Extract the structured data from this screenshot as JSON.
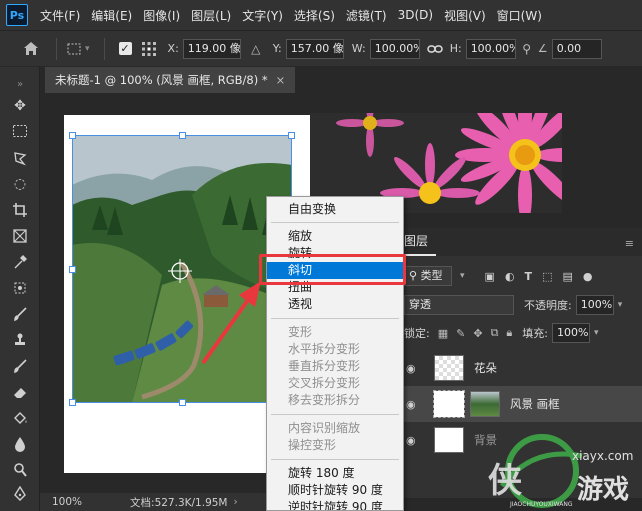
{
  "app": {
    "logo": "Ps"
  },
  "menu": [
    "文件(F)",
    "编辑(E)",
    "图像(I)",
    "图层(L)",
    "文字(Y)",
    "选择(S)",
    "滤镜(T)",
    "3D(D)",
    "视图(V)",
    "窗口(W)"
  ],
  "options": {
    "x_label": "X:",
    "x_value": "119.00 像",
    "y_label": "Y:",
    "y_value": "157.00 像",
    "w_label": "W:",
    "w_value": "100.00%",
    "h_label": "H:",
    "h_value": "100.00%",
    "angle_value": "0.00"
  },
  "document_tab": {
    "title": "未标题-1 @ 100% (风景 画框, RGB/8) *",
    "close": "×"
  },
  "context_menu": {
    "items": [
      {
        "label": "自由变换",
        "state": "enabled"
      },
      {
        "label": "缩放",
        "state": "enabled"
      },
      {
        "label": "旋转",
        "state": "enabled"
      },
      {
        "label": "斜切",
        "state": "highlighted"
      },
      {
        "label": "扭曲",
        "state": "enabled"
      },
      {
        "label": "透视",
        "state": "enabled"
      },
      {
        "label": "变形",
        "state": "disabled"
      },
      {
        "label": "水平拆分变形",
        "state": "disabled"
      },
      {
        "label": "垂直拆分变形",
        "state": "disabled"
      },
      {
        "label": "交叉拆分变形",
        "state": "disabled"
      },
      {
        "label": "移去变形拆分",
        "state": "disabled"
      },
      {
        "label": "内容识别缩放",
        "state": "disabled"
      },
      {
        "label": "操控变形",
        "state": "disabled"
      },
      {
        "label": "旋转 180 度",
        "state": "enabled"
      },
      {
        "label": "顺时针旋转 90 度",
        "state": "enabled"
      },
      {
        "label": "逆时针旋转 90 度",
        "state": "enabled"
      }
    ]
  },
  "layers_panel": {
    "tab": "图层",
    "filter_label": "类型",
    "blend_mode": "穿透",
    "opacity_label": "不透明度:",
    "opacity_value": "100%",
    "lock_label": "锁定:",
    "fill_label": "填充:",
    "fill_value": "100%",
    "layers": [
      {
        "name": "花朵",
        "selected": false
      },
      {
        "name": "风景 画框",
        "selected": true
      },
      {
        "name": "背景",
        "selected": false
      }
    ]
  },
  "status": {
    "zoom": "100%",
    "doc_size": "文档:527.3K/1.95M"
  },
  "watermark": {
    "site": "xiayx.com",
    "brand": "游戏",
    "sub": "JIAOCHUYOUXIWANG"
  },
  "colors": {
    "highlight": "#0078d7",
    "annotation": "#e8383d",
    "accent": "#31a8ff"
  }
}
